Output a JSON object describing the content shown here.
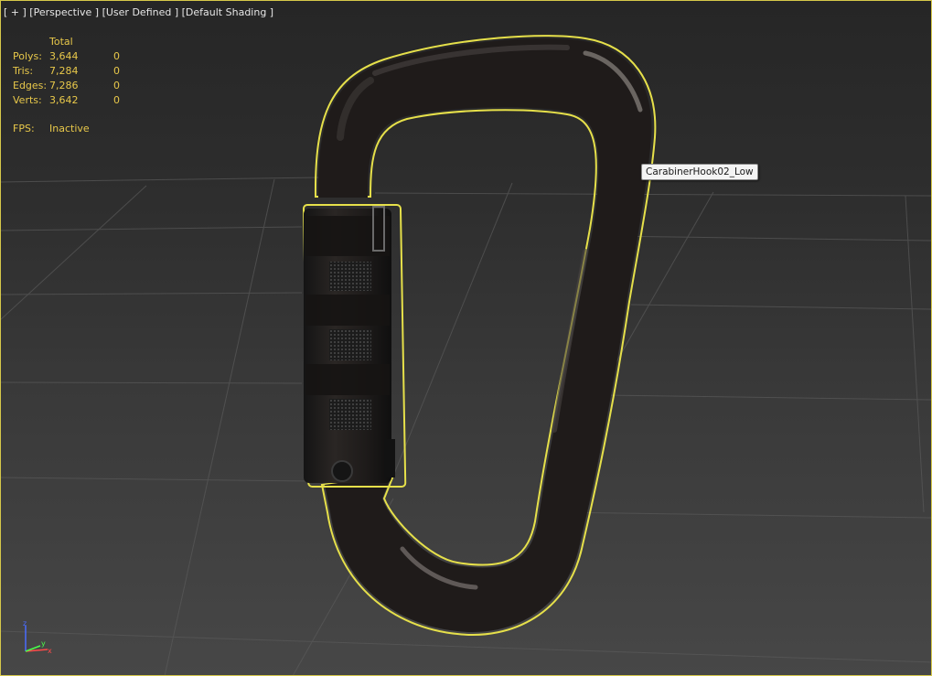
{
  "viewport": {
    "labels": [
      "[ + ]",
      "[Perspective ]",
      "[User Defined ]",
      "[Default Shading ]"
    ]
  },
  "stats": {
    "header": "Total",
    "rows": [
      {
        "label": "Polys:",
        "total": "3,644",
        "selected": "0"
      },
      {
        "label": "Tris:",
        "total": "7,284",
        "selected": "0"
      },
      {
        "label": "Edges:",
        "total": "7,286",
        "selected": "0"
      },
      {
        "label": "Verts:",
        "total": "3,642",
        "selected": "0"
      }
    ],
    "fps_label": "FPS:",
    "fps_value": "Inactive"
  },
  "object": {
    "name": "CarabinerHook02_Low"
  },
  "gizmo": {
    "axes": [
      "x",
      "y",
      "z"
    ]
  },
  "colors": {
    "selection_outline": "#e6e04a",
    "stats_text": "#e8c84a",
    "viewport_border": "#d6c84a"
  }
}
